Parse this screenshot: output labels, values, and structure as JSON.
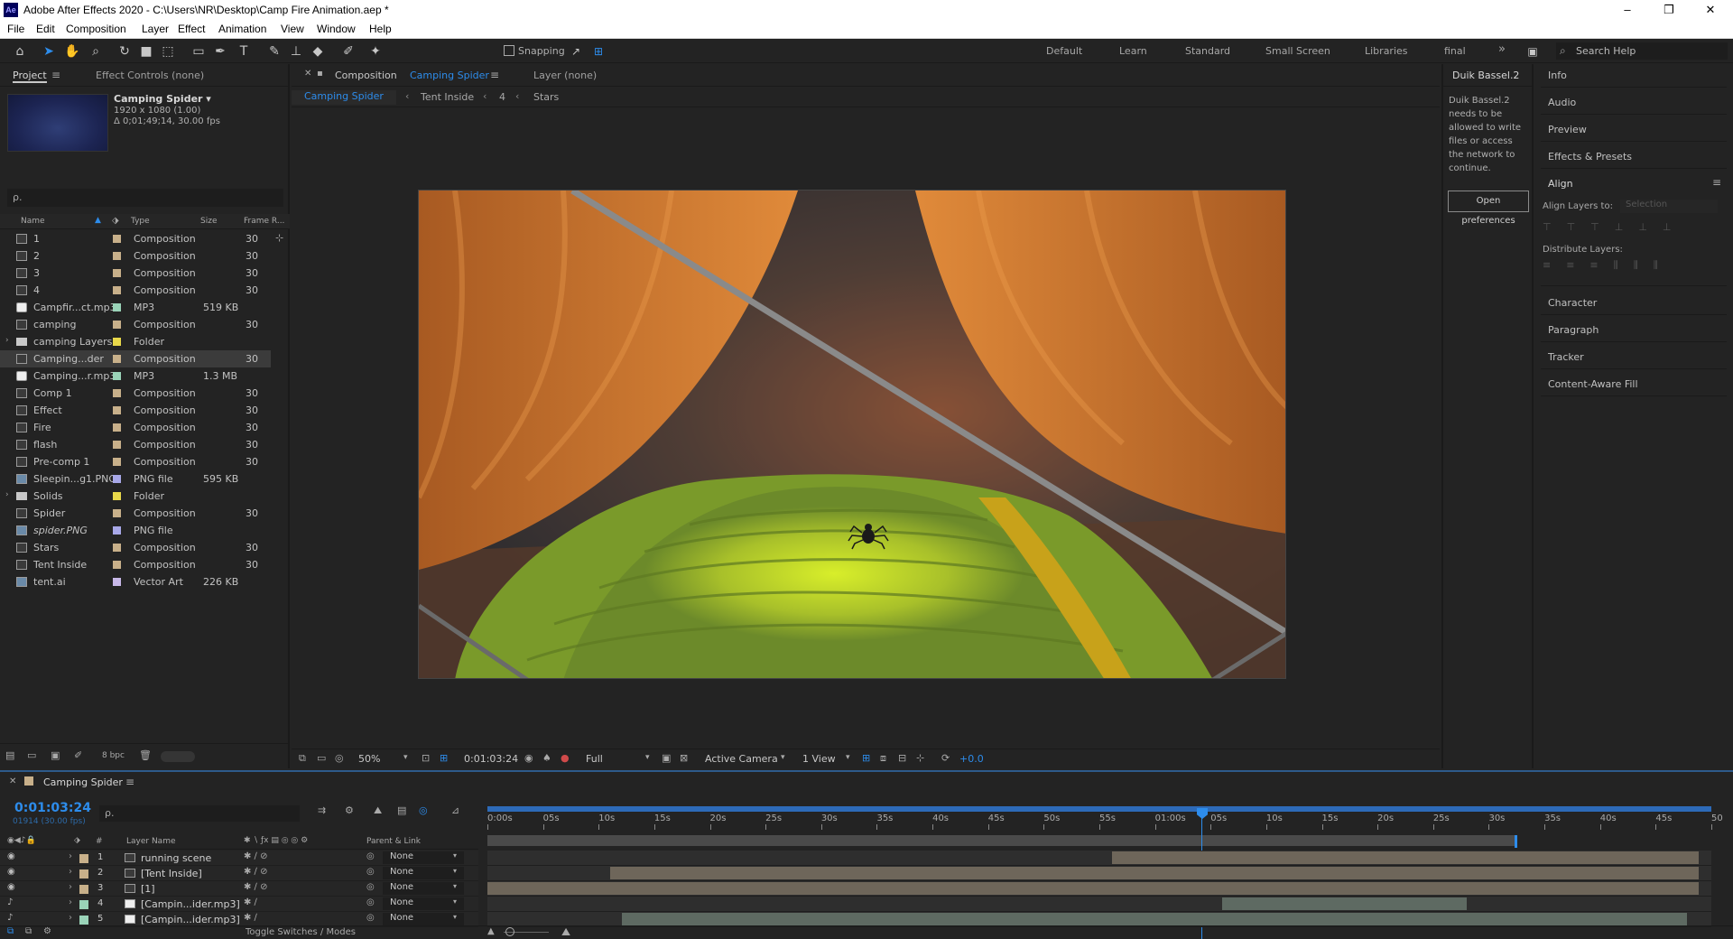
{
  "window": {
    "title": "Adobe After Effects 2020 - C:\\Users\\NR\\Desktop\\Camp Fire Animation.aep *",
    "app_icon": "Ae",
    "buttons": {
      "minimize": "–",
      "restore": "❐",
      "close": "✕"
    }
  },
  "menu": [
    "File",
    "Edit",
    "Composition",
    "Layer",
    "Effect",
    "Animation",
    "View",
    "Window",
    "Help"
  ],
  "toolbar": {
    "snapping_label": "Snapping",
    "workspaces": [
      "Default",
      "Learn",
      "Standard",
      "Small Screen",
      "Libraries",
      "final"
    ],
    "overflow": "»",
    "search_placeholder": "Search Help"
  },
  "project_panel": {
    "tab_project": "Project",
    "tab_effect_controls": "Effect Controls (none)",
    "selected_name": "Camping Spider ▾",
    "selected_res": "1920 x 1080 (1.00)",
    "selected_dur": "Δ 0;01;49;14, 30.00 fps",
    "search_placeholder": "ρ.",
    "columns": {
      "name": "Name",
      "type": "Type",
      "size": "Size",
      "frame_rate": "Frame R..."
    },
    "items": [
      {
        "name": "1",
        "type": "Composition",
        "size": "",
        "fr": "30",
        "label_color": "#c8b08a",
        "kind": "comp"
      },
      {
        "name": "2",
        "type": "Composition",
        "size": "",
        "fr": "30",
        "label_color": "#c8b08a",
        "kind": "comp"
      },
      {
        "name": "3",
        "type": "Composition",
        "size": "",
        "fr": "30",
        "label_color": "#c8b08a",
        "kind": "comp"
      },
      {
        "name": "4",
        "type": "Composition",
        "size": "",
        "fr": "30",
        "label_color": "#c8b08a",
        "kind": "comp"
      },
      {
        "name": "Campfir...ct.mp3",
        "type": "MP3",
        "size": "519 KB",
        "fr": "",
        "label_color": "#9ad3b8",
        "kind": "audio"
      },
      {
        "name": "camping",
        "type": "Composition",
        "size": "",
        "fr": "30",
        "label_color": "#c8b08a",
        "kind": "comp"
      },
      {
        "name": "camping Layers",
        "type": "Folder",
        "size": "",
        "fr": "",
        "label_color": "#e8d84a",
        "kind": "folder"
      },
      {
        "name": "Camping...der",
        "type": "Composition",
        "size": "",
        "fr": "30",
        "label_color": "#c8b08a",
        "kind": "comp"
      },
      {
        "name": "Camping...r.mp3",
        "type": "MP3",
        "size": "1.3 MB",
        "fr": "",
        "label_color": "#9ad3b8",
        "kind": "audio"
      },
      {
        "name": "Comp 1",
        "type": "Composition",
        "size": "",
        "fr": "30",
        "label_color": "#c8b08a",
        "kind": "comp"
      },
      {
        "name": "Effect",
        "type": "Composition",
        "size": "",
        "fr": "30",
        "label_color": "#c8b08a",
        "kind": "comp"
      },
      {
        "name": "Fire",
        "type": "Composition",
        "size": "",
        "fr": "30",
        "label_color": "#c8b08a",
        "kind": "comp"
      },
      {
        "name": "flash",
        "type": "Composition",
        "size": "",
        "fr": "30",
        "label_color": "#c8b08a",
        "kind": "comp"
      },
      {
        "name": "Pre-comp 1",
        "type": "Composition",
        "size": "",
        "fr": "30",
        "label_color": "#c8b08a",
        "kind": "comp"
      },
      {
        "name": "Sleepin...g1.PNG",
        "type": "PNG file",
        "size": "595 KB",
        "fr": "",
        "label_color": "#a8a8e8",
        "kind": "img"
      },
      {
        "name": "Solids",
        "type": "Folder",
        "size": "",
        "fr": "",
        "label_color": "#e8d84a",
        "kind": "folder"
      },
      {
        "name": "Spider",
        "type": "Composition",
        "size": "",
        "fr": "30",
        "label_color": "#c8b08a",
        "kind": "comp"
      },
      {
        "name": "spider.PNG",
        "type": "PNG file",
        "size": "",
        "fr": "",
        "label_color": "#a8a8e8",
        "kind": "img"
      },
      {
        "name": "Stars",
        "type": "Composition",
        "size": "",
        "fr": "30",
        "label_color": "#c8b08a",
        "kind": "comp"
      },
      {
        "name": "Tent Inside",
        "type": "Composition",
        "size": "",
        "fr": "30",
        "label_color": "#c8b08a",
        "kind": "comp"
      },
      {
        "name": "tent.ai",
        "type": "Vector Art",
        "size": "226 KB",
        "fr": "",
        "label_color": "#c8b8e8",
        "kind": "img"
      }
    ],
    "bpc": "8 bpc"
  },
  "comp_panel": {
    "tab_label": "Composition",
    "tab_comp_name": "Camping Spider",
    "tab_layer": "Layer (none)",
    "breadcrumbs": [
      "Camping Spider",
      "Tent Inside",
      "4",
      "Stars"
    ],
    "zoom": "50%",
    "timecode": "0:01:03:24",
    "resolution": "Full",
    "camera": "Active Camera",
    "views": "1 View",
    "exposure": "+0.0"
  },
  "duik_panel": {
    "title": "Duik Bassel.2",
    "message": "Duik Bassel.2 needs to be allowed to write files or access the network to continue.",
    "button": "Open preferences"
  },
  "right_panel": {
    "info": "Info",
    "audio": "Audio",
    "preview": "Preview",
    "effects_presets": "Effects & Presets",
    "align": "Align",
    "align_layers_to": "Align Layers to:",
    "align_target": "Selection",
    "distribute_layers": "Distribute Layers:",
    "character": "Character",
    "paragraph": "Paragraph",
    "tracker": "Tracker",
    "content_aware_fill": "Content-Aware Fill"
  },
  "timeline": {
    "comp_name": "Camping Spider",
    "timecode": "0:01:03:24",
    "frames": "01914 (30.00 fps)",
    "search_placeholder": "ρ.",
    "col_layer_name": "Layer Name",
    "col_parent": "Parent & Link",
    "ruler_labels": [
      "0:00s",
      "05s",
      "10s",
      "15s",
      "20s",
      "25s",
      "30s",
      "35s",
      "40s",
      "45s",
      "50s",
      "55s",
      "01:00s",
      "05s",
      "10s",
      "15s",
      "20s",
      "25s",
      "30s",
      "35s",
      "40s",
      "45s",
      "50"
    ],
    "layers": [
      {
        "num": "1",
        "name": "running scene",
        "parent": "None",
        "label_color": "#c8b08a",
        "kind": "comp",
        "bar_start": 0.51,
        "bar_end": 0.99,
        "bar_color": "#6e665a"
      },
      {
        "num": "2",
        "name": "[Tent Inside]",
        "parent": "None",
        "label_color": "#c8b08a",
        "kind": "comp",
        "bar_start": 0.1,
        "bar_end": 0.99,
        "bar_color": "#6e665a"
      },
      {
        "num": "3",
        "name": "[1]",
        "parent": "None",
        "label_color": "#c8b08a",
        "kind": "comp",
        "bar_start": 0.0,
        "bar_end": 0.99,
        "bar_color": "#6e665a"
      },
      {
        "num": "4",
        "name": "[Campin...ider.mp3]",
        "parent": "None",
        "label_color": "#9ad3b8",
        "kind": "audio",
        "bar_start": 0.6,
        "bar_end": 0.8,
        "bar_color": "#5e6a62"
      },
      {
        "num": "5",
        "name": "[Campin...ider.mp3]",
        "parent": "None",
        "label_color": "#9ad3b8",
        "kind": "audio",
        "bar_start": 0.11,
        "bar_end": 0.98,
        "bar_color": "#5e6a62"
      }
    ],
    "toggle_label": "Toggle Switches / Modes"
  }
}
